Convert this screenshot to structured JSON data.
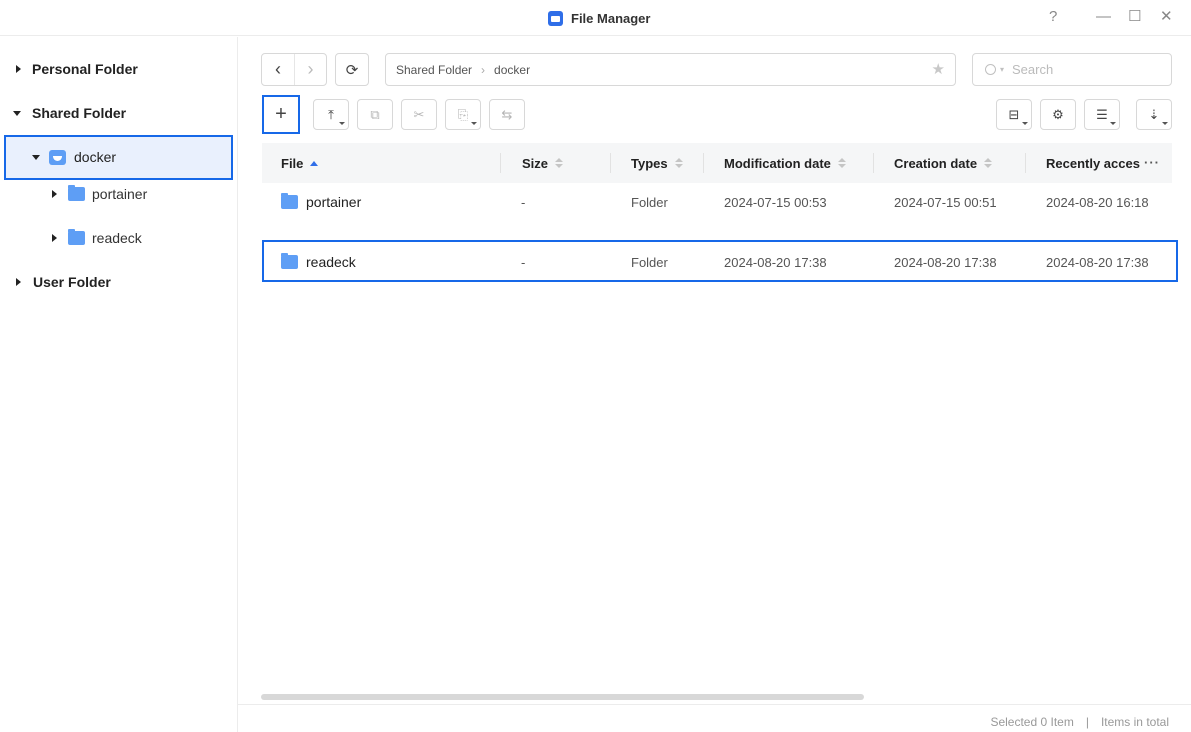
{
  "window": {
    "title": "File Manager",
    "help": "?",
    "minimize": "—",
    "maximize": "☐",
    "close": "✕"
  },
  "sidebar": {
    "personal": "Personal Folder",
    "shared": "Shared Folder",
    "docker": "docker",
    "children": [
      "portainer",
      "readeck"
    ],
    "user": "User Folder"
  },
  "nav": {
    "back": "‹",
    "forward": "›",
    "refresh": "⟳"
  },
  "breadcrumb": {
    "root": "Shared Folder",
    "separator": "›",
    "current": "docker"
  },
  "search": {
    "placeholder": "Search"
  },
  "toolbar": {
    "new": "+",
    "upload": "⤒",
    "copy": "⧉",
    "cut": "✂",
    "paste": "⎘",
    "move": "⇆",
    "tools": "⊟",
    "settings": "⚙",
    "view": "☰",
    "sort": "⇣"
  },
  "table": {
    "columns": [
      "File",
      "Size",
      "Types",
      "Modification date",
      "Creation date",
      "Recently acces"
    ],
    "more": "···",
    "rows": [
      {
        "name": "portainer",
        "size": "-",
        "type": "Folder",
        "modified": "2024-07-15 00:53",
        "created": "2024-07-15 00:51",
        "accessed": "2024-08-20 16:18"
      },
      {
        "name": "readeck",
        "size": "-",
        "type": "Folder",
        "modified": "2024-08-20 17:38",
        "created": "2024-08-20 17:38",
        "accessed": "2024-08-20 17:38"
      }
    ]
  },
  "status": {
    "selected": "Selected 0 Item",
    "divider": "|",
    "total": "Items in total"
  },
  "colors": {
    "accent": "#1668e8",
    "folder": "#5e9ef5",
    "selection_bg": "#e9f0fd"
  }
}
